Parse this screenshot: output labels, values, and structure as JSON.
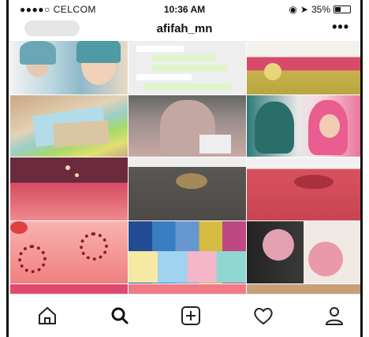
{
  "status_bar": {
    "carrier": "●●●●○ CELCOM",
    "time": "10:36 AM",
    "battery": "35%"
  },
  "header": {
    "username": "afifah_mn",
    "more": "•••"
  },
  "tabs": [
    {
      "name": "home",
      "icon": "home-icon"
    },
    {
      "name": "search",
      "icon": "search-icon"
    },
    {
      "name": "add",
      "icon": "add-post-icon"
    },
    {
      "name": "activity",
      "icon": "heart-icon"
    },
    {
      "name": "profile",
      "icon": "profile-icon"
    }
  ],
  "colors": {
    "accent": "#111111",
    "row1": [
      "#8fb9c9",
      "#cfcfcf",
      "#c8b24e"
    ],
    "row2": [
      "#d8c9a8",
      "#a89892",
      "#2e7a78"
    ],
    "row3": [
      "#c94a5e",
      "#5a5654",
      "#d8525e"
    ],
    "row4": [
      "#f08080",
      "#7a8fb3",
      "#2a2a2a"
    ],
    "row5": [
      "#e04a6e",
      "#f07b86",
      "#c8a078"
    ]
  }
}
